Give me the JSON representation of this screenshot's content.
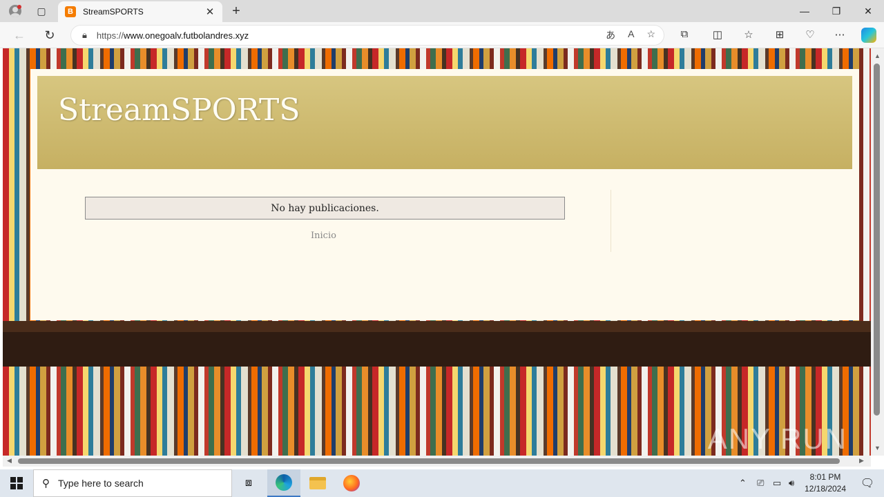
{
  "browser": {
    "tab_title": "StreamSPORTS",
    "tab_favicon_letter": "B",
    "url_prefix": "https://",
    "url_host": "www.onegoalv.futbolandres.xyz"
  },
  "page": {
    "blog_title": "StreamSPORTS",
    "no_posts_message": "No hay publicaciones.",
    "home_link": "Inicio",
    "watermark": "ANY RUN"
  },
  "taskbar": {
    "search_placeholder": "Type here to search",
    "time": "8:01 PM",
    "date": "12/18/2024"
  },
  "colors": {
    "header_gold": "#c6b062",
    "page_background": "#fefaee",
    "favicon_orange": "#f57c00"
  }
}
